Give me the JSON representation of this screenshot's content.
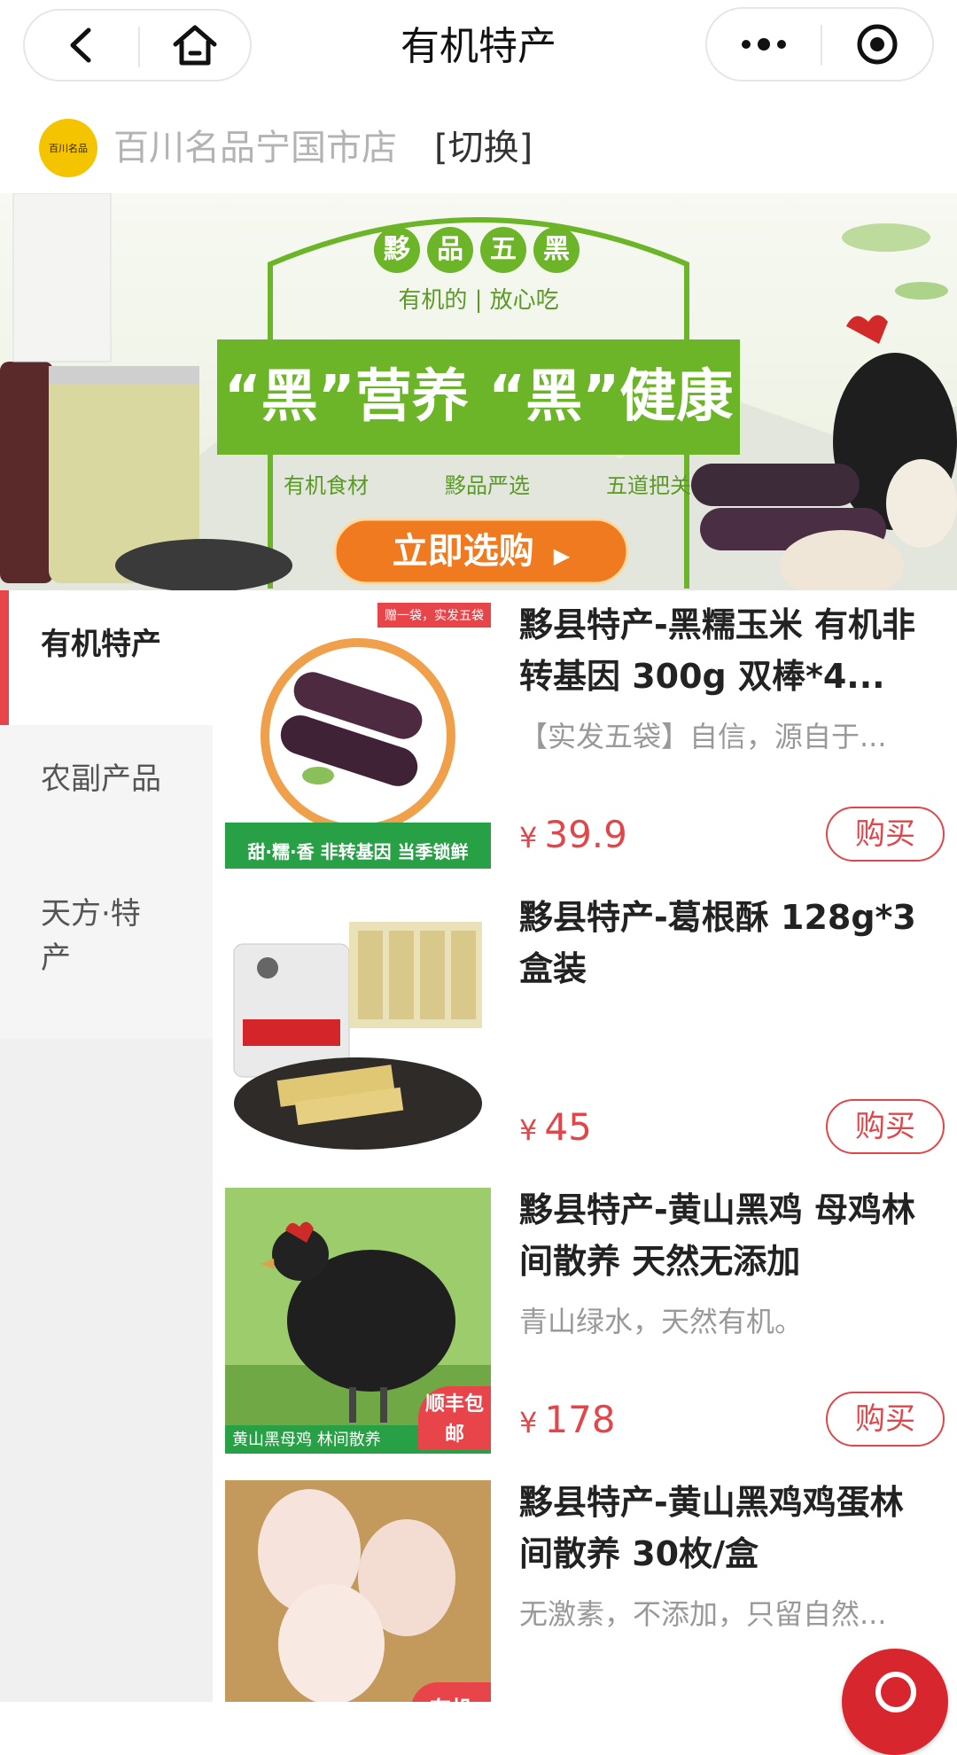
{
  "nav": {
    "title": "有机特产"
  },
  "store": {
    "logo_text": "百川名品",
    "name": "百川名品宁国市店",
    "switch_label": "[切换]"
  },
  "banner": {
    "seal_chars": [
      "黟",
      "品",
      "五",
      "黑"
    ],
    "subtitle": "有机的 | 放心吃",
    "headline": "“黑”营养 “黑”健康",
    "features": [
      "有机食材",
      "黟品严选",
      "五道把关"
    ],
    "cta": "立即选购"
  },
  "categories": [
    {
      "label": "有机特产",
      "active": true
    },
    {
      "label": "农副产品",
      "active": false
    },
    {
      "label": "天方·特产",
      "active": false
    }
  ],
  "products": [
    {
      "title": "黟县特产-黑糯玉米 有机非转基因 300g 双棒*4...",
      "desc": "【实发五袋】自信，源自于...",
      "currency": "¥",
      "price": "39.9",
      "buy_label": "购买",
      "thumb_tag": "赠一袋，实发五袋",
      "thumb_bottom": "甜·糯·香 非转基因 当季锁鲜"
    },
    {
      "title": "黟县特产-葛根酥 128g*3盒装",
      "desc": "",
      "currency": "¥",
      "price": "45",
      "buy_label": "购买",
      "thumb_tag": "",
      "thumb_bottom": ""
    },
    {
      "title": "黟县特产-黄山黑鸡 母鸡林间散养 天然无添加",
      "desc": "青山绿水，天然有机。",
      "currency": "¥",
      "price": "178",
      "buy_label": "购买",
      "thumb_tag": "顺丰包邮",
      "thumb_bottom": "黄山黑母鸡 林间散养"
    },
    {
      "title": "黟县特产-黄山黑鸡鸡蛋林间散养 30枚/盒",
      "desc": "无激素，不添加，只留自然...",
      "currency": "¥",
      "price": "",
      "buy_label": "",
      "thumb_tag": "有机",
      "thumb_bottom": ""
    }
  ],
  "colors": {
    "accent": "#e0474b",
    "sidebar_bg": "#f5f5f5",
    "banner_green": "#6cb528",
    "cta_orange": "#f07a1f"
  }
}
